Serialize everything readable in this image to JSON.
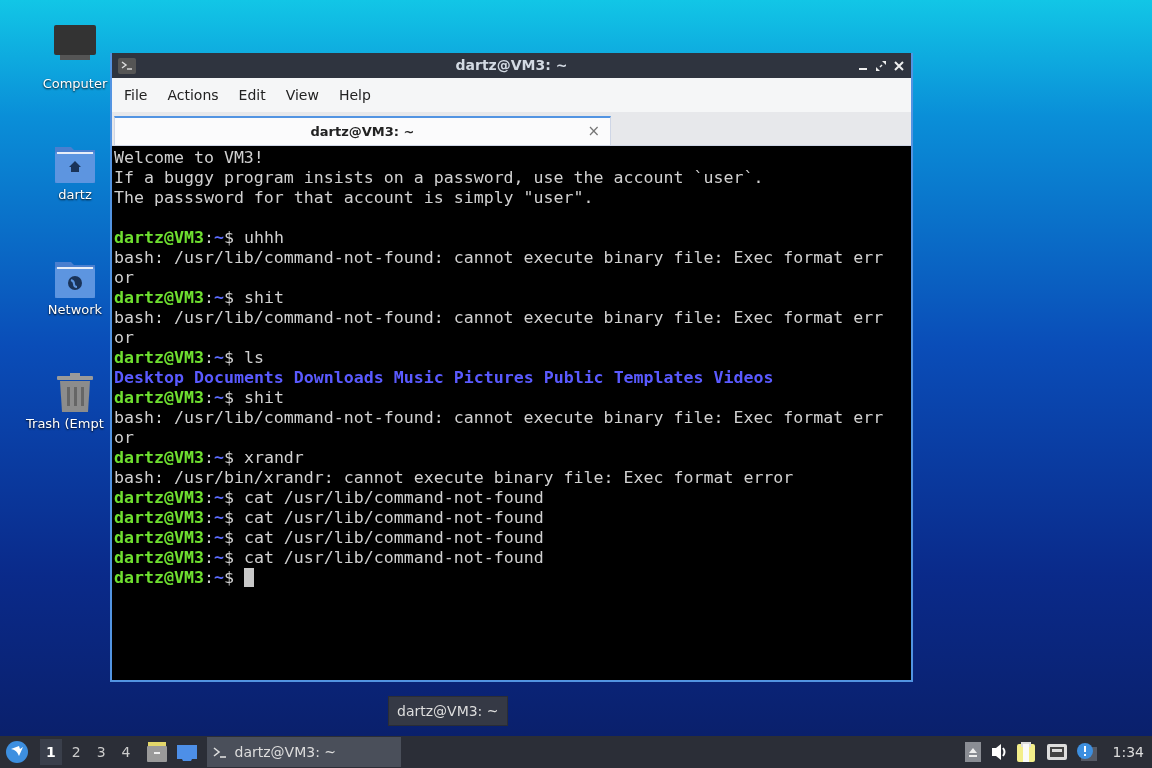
{
  "desktop_icons": [
    {
      "kind": "computer",
      "label": "Computer"
    },
    {
      "kind": "home",
      "label": "dartz"
    },
    {
      "kind": "network",
      "label": "Network"
    },
    {
      "kind": "trash",
      "label": "Trash (Empt"
    }
  ],
  "window": {
    "title": "dartz@VM3: ~",
    "menu": [
      "File",
      "Actions",
      "Edit",
      "View",
      "Help"
    ],
    "tabs": [
      {
        "label": "dartz@VM3: ~",
        "selected": true,
        "close": "×"
      }
    ],
    "terminal": [
      {
        "kind": "text",
        "text": "Welcome to VM3!"
      },
      {
        "kind": "text",
        "text": "If a buggy program insists on a password, use the account `user`."
      },
      {
        "kind": "text",
        "text": "The passsword for that account is simply \"user\"."
      },
      {
        "kind": "blank"
      },
      {
        "kind": "prompt",
        "user": "dartz@VM3",
        "colon": ":",
        "cwd": "~",
        "symbol": "$",
        "command": "uhhh",
        "cursor": false
      },
      {
        "kind": "text",
        "text": "bash: /usr/lib/command-not-found: cannot execute binary file: Exec format err"
      },
      {
        "kind": "text",
        "text": "or"
      },
      {
        "kind": "prompt",
        "user": "dartz@VM3",
        "colon": ":",
        "cwd": "~",
        "symbol": "$",
        "command": "shit",
        "cursor": false
      },
      {
        "kind": "text",
        "text": "bash: /usr/lib/command-not-found: cannot execute binary file: Exec format err"
      },
      {
        "kind": "text",
        "text": "or"
      },
      {
        "kind": "prompt",
        "user": "dartz@VM3",
        "colon": ":",
        "cwd": "~",
        "symbol": "$",
        "command": "ls",
        "cursor": false
      },
      {
        "kind": "listing",
        "items": [
          "Desktop",
          "Documents",
          "Downloads",
          "Music",
          "Pictures",
          "Public",
          "Templates",
          "Videos"
        ]
      },
      {
        "kind": "prompt",
        "user": "dartz@VM3",
        "colon": ":",
        "cwd": "~",
        "symbol": "$",
        "command": "shit",
        "cursor": false
      },
      {
        "kind": "text",
        "text": "bash: /usr/lib/command-not-found: cannot execute binary file: Exec format err"
      },
      {
        "kind": "text",
        "text": "or"
      },
      {
        "kind": "prompt",
        "user": "dartz@VM3",
        "colon": ":",
        "cwd": "~",
        "symbol": "$",
        "command": "xrandr",
        "cursor": false
      },
      {
        "kind": "text",
        "text": "bash: /usr/bin/xrandr: cannot execute binary file: Exec format error"
      },
      {
        "kind": "prompt",
        "user": "dartz@VM3",
        "colon": ":",
        "cwd": "~",
        "symbol": "$",
        "command": "cat /usr/lib/command-not-found",
        "cursor": false
      },
      {
        "kind": "prompt",
        "user": "dartz@VM3",
        "colon": ":",
        "cwd": "~",
        "symbol": "$",
        "command": "cat /usr/lib/command-not-found",
        "cursor": false
      },
      {
        "kind": "prompt",
        "user": "dartz@VM3",
        "colon": ":",
        "cwd": "~",
        "symbol": "$",
        "command": "cat /usr/lib/command-not-found",
        "cursor": false
      },
      {
        "kind": "prompt",
        "user": "dartz@VM3",
        "colon": ":",
        "cwd": "~",
        "symbol": "$",
        "command": "cat /usr/lib/command-not-found",
        "cursor": false
      },
      {
        "kind": "prompt",
        "user": "dartz@VM3",
        "colon": ":",
        "cwd": "~",
        "symbol": "$",
        "cursor": true
      }
    ]
  },
  "taskbar": {
    "workspaces": [
      {
        "label": "1",
        "selected": true
      },
      {
        "label": "2",
        "selected": false
      },
      {
        "label": "3",
        "selected": false
      },
      {
        "label": "4",
        "selected": false
      }
    ],
    "tasks": [
      {
        "label": "dartz@VM3: ~",
        "selected": true
      }
    ],
    "tooltip": "dartz@VM3: ~",
    "clock": "1:34"
  }
}
